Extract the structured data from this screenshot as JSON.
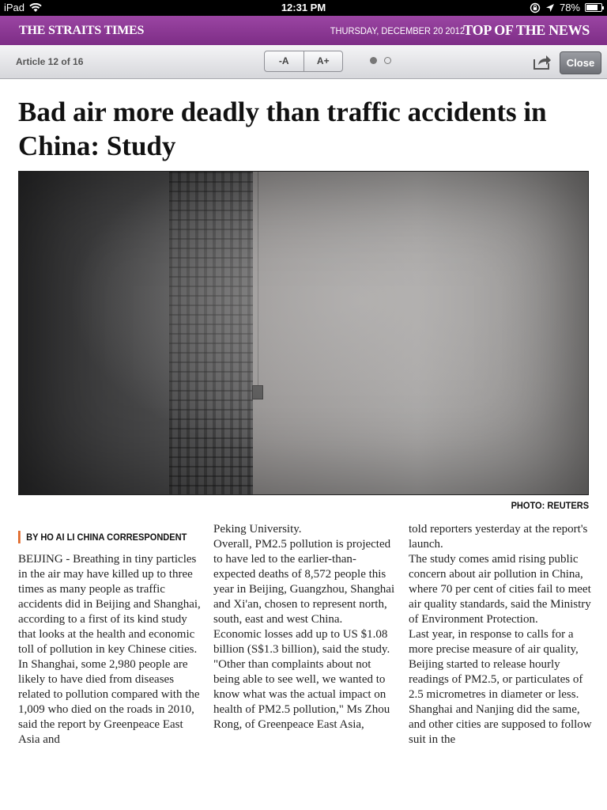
{
  "statusbar": {
    "device": "iPad",
    "time": "12:31 PM",
    "battery": "78%",
    "battery_level": 0.78
  },
  "masthead": {
    "brand": "THE STRAITS TIMES",
    "date": "THURSDAY, DECEMBER 20 2012",
    "section": "TOP OF THE NEWS",
    "color": "#8a3893"
  },
  "toolbar": {
    "counter": "Article 12 of 16",
    "decrease_font": "-A",
    "increase_font": "A+",
    "close": "Close",
    "page_dots": {
      "total": 2,
      "active": 1
    }
  },
  "article": {
    "headline": "Bad air more deadly than traffic accidents in China: Study",
    "photo_credit": "PHOTO: REUTERS",
    "byline": "BY HO AI LI CHINA CORRESPONDENT",
    "accent_color": "#e0692a",
    "columns": [
      "BEIJING - Breathing in tiny particles in the air may have killed up to three times as many people as traffic accidents did in Beijing and Shanghai, according to a first of its kind study that looks at the health and economic toll of pollution in key Chinese cities.\n In Shanghai, some 2,980 people are likely to have died from diseases related to pollution compared with the 1,009 who died on the roads in 2010, said the report by Greenpeace East Asia and",
      "Peking University.\n Overall, PM2.5 pollution is projected to have led to the earlier-than-expected deaths of 8,572 people this year in Beijing, Guangzhou, Shanghai and Xi'an, chosen to represent north, south, east and west China.\n Economic losses add up to US $1.08 billion (S$1.3 billion), said the study.\n\"Other than complaints about not being able to see well, we wanted to know what was the actual impact on health of PM2.5 pollution,\" Ms Zhou Rong, of Greenpeace East Asia,",
      "told reporters yesterday at the report's launch.\n The study comes amid rising public concern about air pollution in China, where 70 per cent of cities fail to meet air quality standards, said the Ministry of Environment Protection.\n Last year, in response to calls for a more precise measure of air quality, Beijing started to release hourly readings of PM2.5, or particulates of 2.5 micrometres in diameter or less. Shanghai and Nanjing did the same, and other cities are supposed to follow suit in the"
    ]
  }
}
